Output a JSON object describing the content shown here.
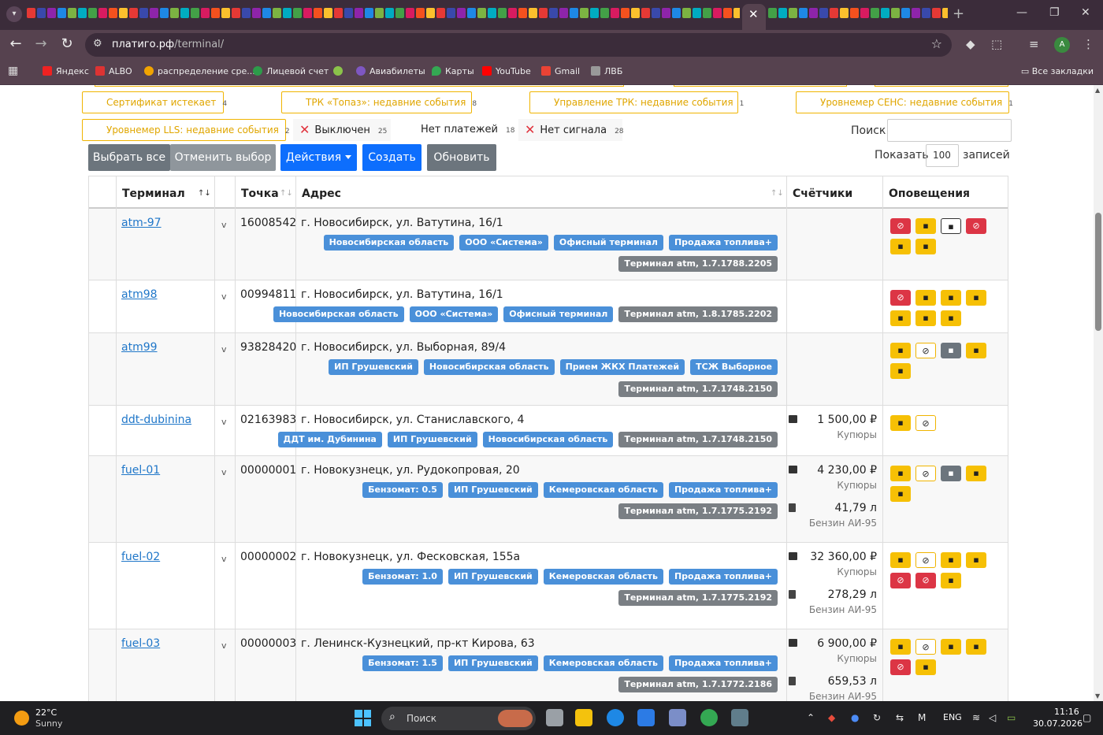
{
  "browser": {
    "url_domain": "платиго.рф",
    "url_path": "/terminal/",
    "profile_initial": "A",
    "bookmarks": [
      "Яндекс",
      "ALBO",
      "распределение сре...",
      "Лицевой счет",
      "Авиабилеты",
      "Карты",
      "YouTube",
      "Gmail",
      "ЛВБ"
    ],
    "all_bookmarks": "Все закладки"
  },
  "filters": {
    "row1": [
      {
        "label": "Сертификат истекает",
        "count": "4"
      },
      {
        "label": "ТРК «Топаз»: недавние события",
        "count": "8"
      },
      {
        "label": "Управление ТРК: недавние события",
        "count": "1"
      },
      {
        "label": "Уровнемер СЕНС: недавние события",
        "count": "1"
      }
    ],
    "llsf": {
      "label": "Уровнемер LLS: недавние события",
      "count": "2"
    },
    "off": {
      "label": "Выключен",
      "count": "25"
    },
    "nopay": {
      "label": "Нет платежей",
      "count": "18"
    },
    "nosig": {
      "label": "Нет сигнала",
      "count": "28"
    }
  },
  "search": {
    "label": "Поиск",
    "value": ""
  },
  "show": {
    "label": "Показать",
    "value": "100",
    "suffix": "записей"
  },
  "buttons": {
    "select_all": "Выбрать все",
    "deselect": "Отменить выбор",
    "actions": "Действия",
    "create": "Создать",
    "refresh": "Обновить"
  },
  "table": {
    "headers": {
      "terminal": "Терминал",
      "point": "Точка",
      "address": "Адрес",
      "counters": "Счётчики",
      "alerts": "Оповещения"
    },
    "rows": [
      {
        "terminal": "atm-97",
        "point": "16008542",
        "address": "г. Новосибирск, ул. Ватутина, 16/1",
        "tags": [
          "Новосибирская область",
          "ООО «Система»",
          "Офисный терминал",
          "Продажа топлива+"
        ],
        "version": "Терминал atm, 1.7.1788.2205",
        "counters": []
      },
      {
        "terminal": "atm98",
        "point": "00994811",
        "address": "г. Новосибирск, ул. Ватутина, 16/1",
        "tags": [
          "Новосибирская область",
          "ООО «Система»",
          "Офисный терминал"
        ],
        "version": "Терминал atm, 1.8.1785.2202",
        "counters": []
      },
      {
        "terminal": "atm99",
        "point": "93828420",
        "address": "г. Новосибирск, ул. Выборная, 89/4",
        "tags": [
          "ИП Грушевский",
          "Новосибирская область",
          "Прием ЖКХ Платежей",
          "ТСЖ Выборное"
        ],
        "version": "Терминал atm, 1.7.1748.2150",
        "counters": []
      },
      {
        "terminal": "ddt-dubinina",
        "point": "02163983",
        "address": "г. Новосибирск, ул. Станиславского, 4",
        "tags": [
          "ДДТ им. Дубинина",
          "ИП Грушевский",
          "Новосибирская область",
          "Терминал atm, 1.7.1748.2150"
        ],
        "version": "",
        "counters": [
          {
            "amount": "1 500,00 ₽",
            "label": "Купюры"
          }
        ]
      },
      {
        "terminal": "fuel-01",
        "point": "00000001",
        "address": "г. Новокузнецк, ул. Рудокопровая, 20",
        "tags": [
          "Бензомат: 0.5",
          "ИП Грушевский",
          "Кемеровская область",
          "Продажа топлива+"
        ],
        "version": "Терминал atm, 1.7.1775.2192",
        "counters": [
          {
            "amount": "4 230,00 ₽",
            "label": "Купюры"
          },
          {
            "amount": "41,79 л",
            "label": "Бензин АИ-95"
          }
        ]
      },
      {
        "terminal": "fuel-02",
        "point": "00000002",
        "address": "г. Новокузнецк, ул. Фесковская, 155а",
        "tags": [
          "Бензомат: 1.0",
          "ИП Грушевский",
          "Кемеровская область",
          "Продажа топлива+"
        ],
        "version": "Терминал atm, 1.7.1775.2192",
        "counters": [
          {
            "amount": "32 360,00 ₽",
            "label": "Купюры"
          },
          {
            "amount": "278,29 л",
            "label": "Бензин АИ-95"
          }
        ]
      },
      {
        "terminal": "fuel-03",
        "point": "00000003",
        "address": "г. Ленинск-Кузнецкий, пр-кт Кирова, 63",
        "tags": [
          "Бензомат: 1.5",
          "ИП Грушевский",
          "Кемеровская область",
          "Продажа топлива+"
        ],
        "version": "Терминал atm, 1.7.1772.2186",
        "counters": [
          {
            "amount": "6 900,00 ₽",
            "label": "Купюры"
          },
          {
            "amount": "659,53 л",
            "label": "Бензин АИ-95"
          }
        ]
      }
    ]
  },
  "taskbar": {
    "temp": "22°C",
    "weather": "Sunny",
    "search": "Поиск",
    "lang": "ENG",
    "time": "11:16",
    "date": "30.07.2026"
  },
  "colors": {
    "accent_blue": "#0d6efd",
    "tag_blue": "#4a90d9",
    "warning": "#f6c005",
    "danger": "#dc3545",
    "link": "#2077c9"
  }
}
